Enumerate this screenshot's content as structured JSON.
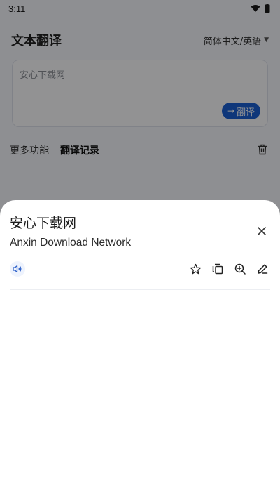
{
  "status_bar": {
    "time": "3:11"
  },
  "header": {
    "title": "文本翻译",
    "language_pair": "简体中文/英语"
  },
  "input": {
    "text": "安心下载网",
    "translate_label": "翻译"
  },
  "tabs": [
    {
      "label": "更多功能",
      "active": false
    },
    {
      "label": "翻译记录",
      "active": true
    }
  ],
  "result_sheet": {
    "source_text": "安心下载网",
    "translation": "Anxin Download Network"
  },
  "colors": {
    "accent": "#1a5fd3",
    "scrim": "rgba(0,0,0,0.42)"
  },
  "icons": [
    "wifi-icon",
    "battery-icon",
    "caret-down-icon",
    "arrow-right-icon",
    "trash-icon",
    "close-icon",
    "speaker-icon",
    "star-icon",
    "copy-icon",
    "zoom-in-icon",
    "edit-icon"
  ]
}
